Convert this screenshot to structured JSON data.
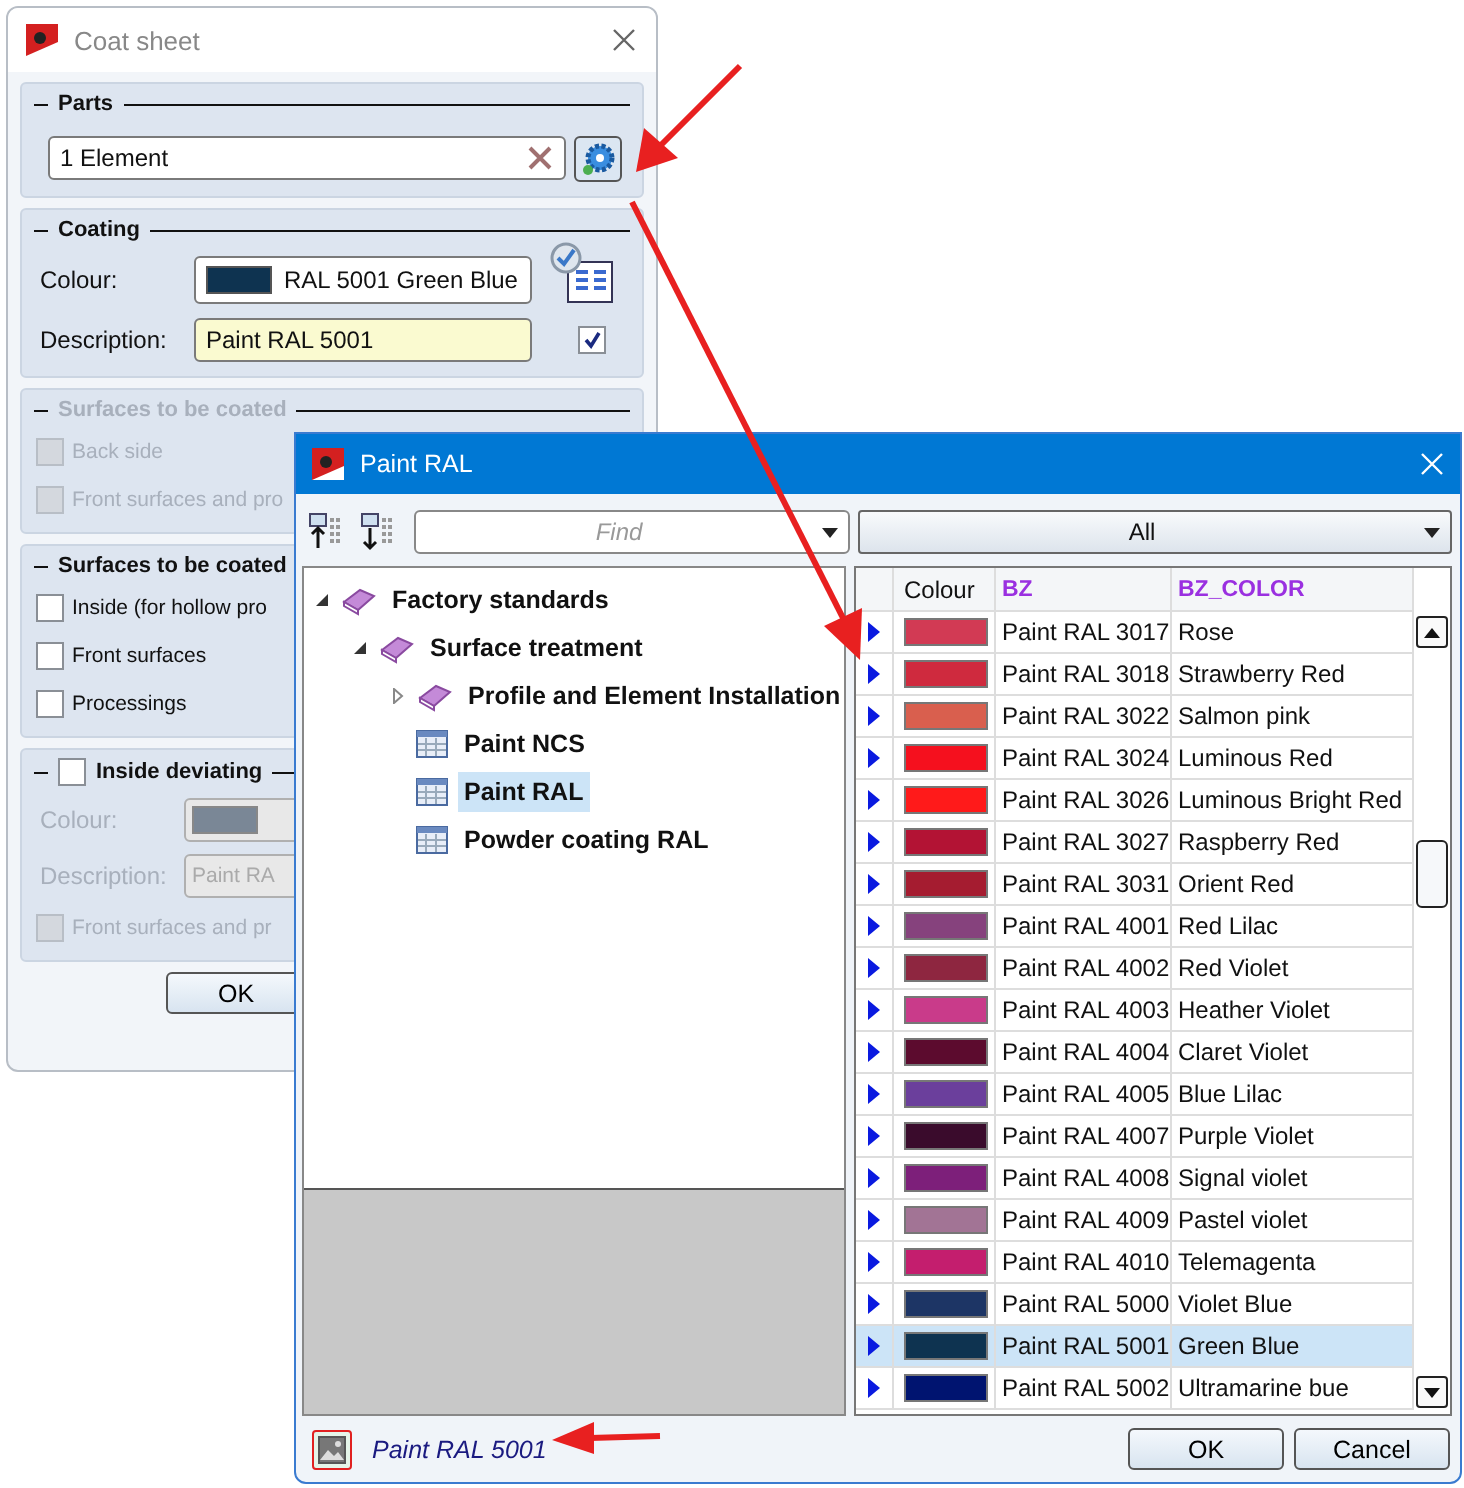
{
  "coat_sheet": {
    "title": "Coat sheet",
    "parts": {
      "heading": "Parts",
      "value": "1 Element"
    },
    "coating": {
      "heading": "Coating",
      "colour_label": "Colour:",
      "colour_value": "RAL 5001 Green Blue",
      "color": "#0e3350",
      "description_label": "Description:",
      "description_value": "Paint RAL 5001",
      "checked": true
    },
    "surfaces_hidden": {
      "heading": "Surfaces to be coated",
      "disabled": true,
      "options": [
        {
          "label": "Back side",
          "checked": false
        },
        {
          "label": "Front surfaces and pro",
          "checked": false
        }
      ]
    },
    "surfaces": {
      "heading": "Surfaces to be coated",
      "disabled": false,
      "options": [
        {
          "label": "Inside (for hollow pro",
          "checked": false
        },
        {
          "label": "Front surfaces",
          "checked": false
        },
        {
          "label": "Processings",
          "checked": false
        }
      ]
    },
    "inside_deviating": {
      "label": "Inside deviating",
      "checked": false,
      "colour_label": "Colour:",
      "color": "#7a8796",
      "description_label": "Description:",
      "description_value": "Paint RA",
      "option": {
        "label": "Front surfaces and pr",
        "checked": false
      }
    },
    "ok": "OK"
  },
  "paint_ral": {
    "title": "Paint RAL",
    "find_placeholder": "Find",
    "filter": "All",
    "tree": [
      {
        "label": "Factory standards",
        "kind": "book",
        "expanded": true,
        "selected": false,
        "children": [
          {
            "label": "Surface treatment",
            "kind": "book",
            "expanded": true,
            "selected": false,
            "children": [
              {
                "label": "Profile and Element Installation",
                "kind": "book",
                "expanded": false,
                "selected": false
              },
              {
                "label": "Paint NCS",
                "kind": "table",
                "selected": false
              },
              {
                "label": "Paint RAL",
                "kind": "table",
                "selected": true
              },
              {
                "label": "Powder coating RAL",
                "kind": "table",
                "selected": false
              }
            ]
          }
        ]
      }
    ],
    "columns": [
      "Colour",
      "BZ",
      "BZ_COLOR"
    ],
    "rows": [
      {
        "color": "#d23a54",
        "bz": "Paint RAL 3017",
        "bz_color": "Rose",
        "selected": false
      },
      {
        "color": "#cf2a3e",
        "bz": "Paint RAL 3018",
        "bz_color": "Strawberry Red",
        "selected": false
      },
      {
        "color": "#d95f4e",
        "bz": "Paint RAL 3022",
        "bz_color": "Salmon pink",
        "selected": false
      },
      {
        "color": "#f5101e",
        "bz": "Paint RAL 3024",
        "bz_color": "Luminous Red",
        "selected": false
      },
      {
        "color": "#ff1a1a",
        "bz": "Paint RAL 3026",
        "bz_color": "Luminous Bright Red",
        "selected": false
      },
      {
        "color": "#b31334",
        "bz": "Paint RAL 3027",
        "bz_color": "Raspberry Red",
        "selected": false
      },
      {
        "color": "#a51c30",
        "bz": "Paint RAL 3031",
        "bz_color": "Orient Red",
        "selected": false
      },
      {
        "color": "#86427d",
        "bz": "Paint RAL 4001",
        "bz_color": "Red Lilac",
        "selected": false
      },
      {
        "color": "#8e2640",
        "bz": "Paint RAL 4002",
        "bz_color": "Red Violet",
        "selected": false
      },
      {
        "color": "#c93b8a",
        "bz": "Paint RAL 4003",
        "bz_color": "Heather Violet",
        "selected": false
      },
      {
        "color": "#5c0b2e",
        "bz": "Paint RAL 4004",
        "bz_color": "Claret Violet",
        "selected": false
      },
      {
        "color": "#6b3f9c",
        "bz": "Paint RAL 4005",
        "bz_color": "Blue Lilac",
        "selected": false
      },
      {
        "color": "#3a0b2c",
        "bz": "Paint RAL 4007",
        "bz_color": "Purple Violet",
        "selected": false
      },
      {
        "color": "#7d1f7a",
        "bz": "Paint RAL 4008",
        "bz_color": "Signal violet",
        "selected": false
      },
      {
        "color": "#a27495",
        "bz": "Paint RAL 4009",
        "bz_color": "Pastel violet",
        "selected": false
      },
      {
        "color": "#c41e6e",
        "bz": "Paint RAL 4010",
        "bz_color": "Telemagenta",
        "selected": false
      },
      {
        "color": "#1d3565",
        "bz": "Paint RAL 5000",
        "bz_color": "Violet Blue",
        "selected": false
      },
      {
        "color": "#0e3350",
        "bz": "Paint RAL 5001",
        "bz_color": "Green Blue",
        "selected": true
      },
      {
        "color": "#001470",
        "bz": "Paint RAL 5002",
        "bz_color": "Ultramarine bue",
        "selected": false
      }
    ],
    "footer": "Paint RAL 5001",
    "buttons": [
      "OK",
      "Cancel"
    ]
  }
}
